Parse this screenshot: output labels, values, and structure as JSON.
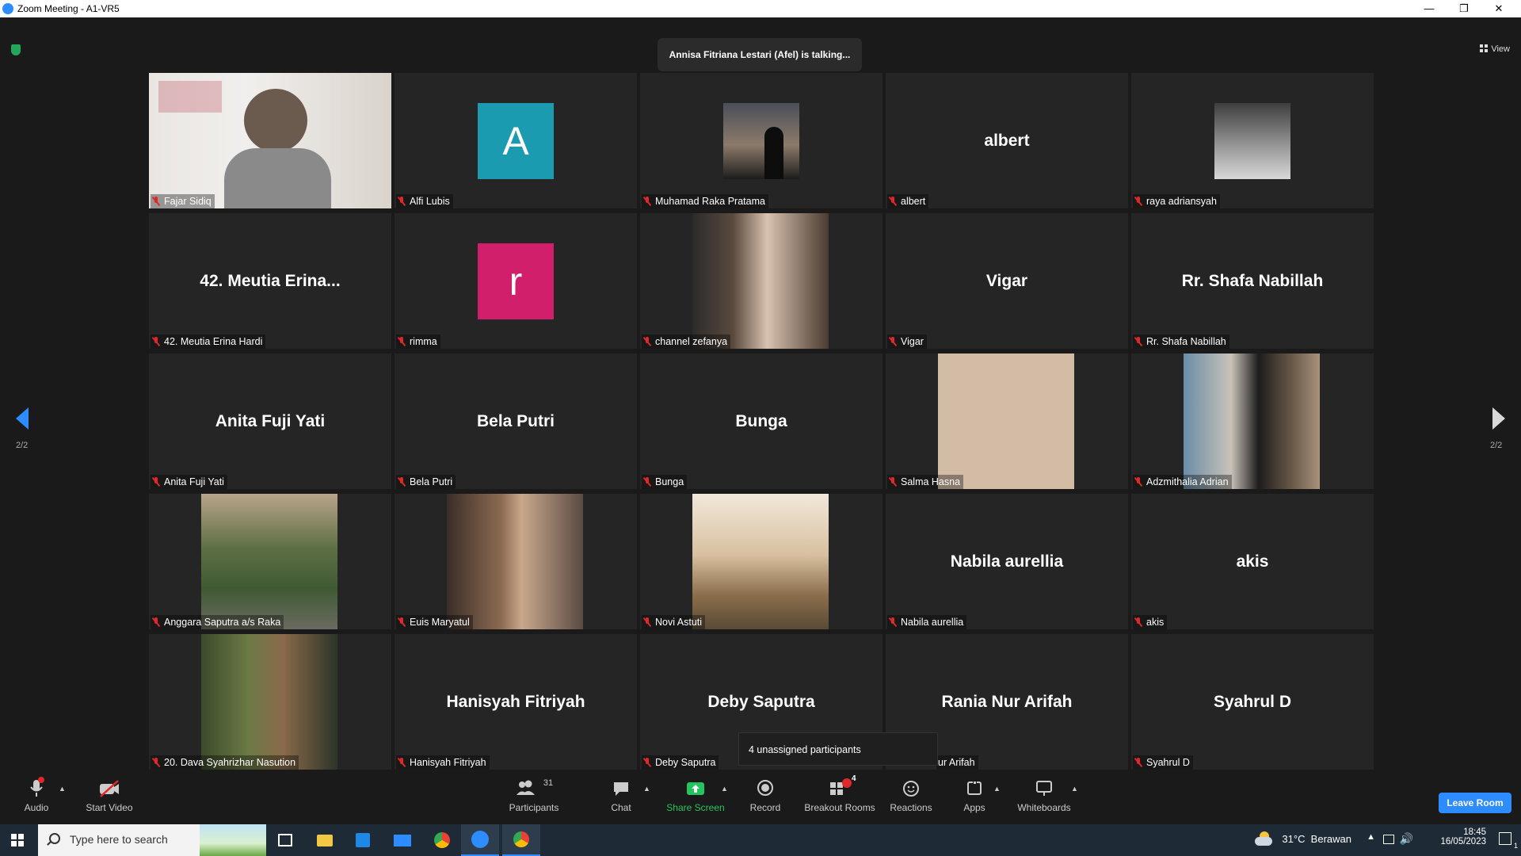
{
  "window": {
    "title": "Zoom Meeting - A1-VR5"
  },
  "meeting": {
    "talking_indicator": "Annisa Fitriana Lestari (Afel) is talking...",
    "view_label": "View",
    "page_left": "2/2",
    "page_right": "2/2",
    "unassigned_popup": "4 unassigned participants"
  },
  "participants": [
    {
      "name": "Fajar Sidiq",
      "big": ""
    },
    {
      "name": "Alfi Lubis",
      "big": ""
    },
    {
      "name": "Muhamad Raka Pratama",
      "big": ""
    },
    {
      "name": "albert",
      "big": "albert"
    },
    {
      "name": "raya adriansyah",
      "big": ""
    },
    {
      "name": "42. Meutia Erina Hardi",
      "big": "42. Meutia Erina..."
    },
    {
      "name": "rimma",
      "big": ""
    },
    {
      "name": "channel zefanya",
      "big": ""
    },
    {
      "name": "Vigar",
      "big": "Vigar"
    },
    {
      "name": "Rr. Shafa Nabillah",
      "big": "Rr. Shafa Nabillah"
    },
    {
      "name": "Anita Fuji Yati",
      "big": "Anita Fuji Yati"
    },
    {
      "name": "Bela Putri",
      "big": "Bela Putri"
    },
    {
      "name": "Bunga",
      "big": "Bunga"
    },
    {
      "name": "Salma Hasna",
      "big": ""
    },
    {
      "name": "Adzmithalia Adrian",
      "big": ""
    },
    {
      "name": "Anggara Saputra a/s Raka",
      "big": ""
    },
    {
      "name": "Euis Maryatul",
      "big": ""
    },
    {
      "name": "Novi Astuti",
      "big": ""
    },
    {
      "name": "Nabila aurellia",
      "big": "Nabila aurellia"
    },
    {
      "name": "akis",
      "big": "akis"
    },
    {
      "name": "20. Dava Syahrizhar Nasution",
      "big": ""
    },
    {
      "name": "Hanisyah Fitriyah",
      "big": "Hanisyah Fitriyah"
    },
    {
      "name": "Deby Saputra",
      "big": "Deby Saputra"
    },
    {
      "name": "ur Arifah",
      "big": "Rania Nur Arifah"
    },
    {
      "name": "Syahrul D",
      "big": "Syahrul D"
    }
  ],
  "avatars": {
    "alfi": "A",
    "rimma": "r"
  },
  "colors": {
    "accent": "#2d8cff",
    "alfi_avatar": "#1a9bb0",
    "rimma_avatar": "#d21f6b",
    "muted": "#e02828",
    "share": "#23c55e"
  },
  "toolbar": {
    "audio": "Audio",
    "start_video": "Start Video",
    "participants": "Participants",
    "participants_count": "31",
    "chat": "Chat",
    "share_screen": "Share Screen",
    "record": "Record",
    "breakout_rooms": "Breakout Rooms",
    "breakout_badge": "4",
    "reactions": "Reactions",
    "apps": "Apps",
    "whiteboards": "Whiteboards",
    "leave": "Leave Room"
  },
  "taskbar": {
    "search_placeholder": "Type here to search",
    "weather": "31°C  Berawan",
    "time": "18:45",
    "date": "16/05/2023",
    "notification_count": "1"
  }
}
